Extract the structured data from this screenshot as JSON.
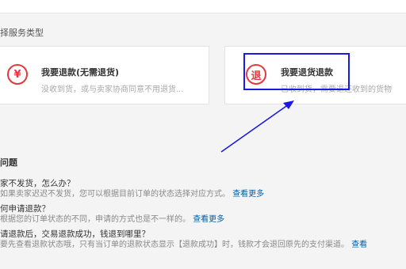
{
  "section_title": "择服务类型",
  "cards": [
    {
      "icon_name": "refund-yen-icon",
      "icon_glyph": "¥",
      "title": "我要退款(无需退货)",
      "description": "没收到货，或与卖家协商同意不用退货..."
    },
    {
      "icon_name": "return-goods-icon",
      "icon_glyph": "退",
      "title": "我要退货退款",
      "description": "已收到货，需要退还收到的货物"
    }
  ],
  "faq": {
    "heading": "问题",
    "items": [
      {
        "question": "家不发货，怎么办？",
        "answer": "如果卖家迟迟不发货，您可以根据目前订单的状态选择对应方式。",
        "more": "查看更多"
      },
      {
        "question": "何申请退款？",
        "answer": "根据您的订单状态的不同，申请的方式也是不一样的。",
        "more": "查看更多"
      },
      {
        "question": "请退款后，交易退款成功，钱退到哪里？",
        "answer": "要先查看退款状态哦，只有当订单的退款状态显示【退款成功】时，钱款才会退回原先的支付渠道。",
        "more": "查看"
      }
    ]
  },
  "colors": {
    "accent_red": "#e4393c",
    "link_blue": "#005ea7",
    "annotation_blue": "#1a1ae0"
  }
}
